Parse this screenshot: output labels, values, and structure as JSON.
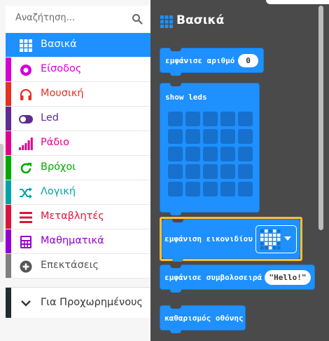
{
  "search": {
    "placeholder": "Αναζήτηση...",
    "icon": "search-icon"
  },
  "categories": [
    {
      "label": "Βασικά",
      "color": "#1e90ff",
      "icon": "grid-icon",
      "selected": true
    },
    {
      "label": "Είσοδος",
      "color": "#d400d4",
      "icon": "circle-dot-icon"
    },
    {
      "label": "Μουσική",
      "color": "#e63022",
      "icon": "headphones-icon"
    },
    {
      "label": "Led",
      "color": "#5c2d91",
      "icon": "toggle-icon"
    },
    {
      "label": "Ράδιο",
      "color": "#e3008c",
      "icon": "signal-bars-icon"
    },
    {
      "label": "Βρόχοι",
      "color": "#00aa00",
      "icon": "refresh-icon"
    },
    {
      "label": "Λογική",
      "color": "#00a4a6",
      "icon": "shuffle-icon"
    },
    {
      "label": "Μεταβλητές",
      "color": "#dc143c",
      "icon": "list-icon"
    },
    {
      "label": "Μαθηματικά",
      "color": "#9400d3",
      "icon": "calculator-icon"
    },
    {
      "label": "Επεκτάσεις",
      "color": "#7f7f7f",
      "icon": "plus-circle-icon"
    }
  ],
  "advanced": {
    "label": "Για Προχωρημένους",
    "icon": "chevron-down-icon"
  },
  "flyout": {
    "title": "Βασικά",
    "blocks": {
      "show_number": {
        "label": "εμφάνισε αριθμό",
        "value": "0"
      },
      "show_leds": {
        "label": "show leds"
      },
      "show_icon": {
        "label": "εμφάνιση εικονιδίου"
      },
      "show_string": {
        "label": "εμφάνισε συμβολοσειρά",
        "value": "\"Hello!\""
      },
      "clear_screen": {
        "label": "καθαρισμός οθόνης"
      }
    }
  }
}
